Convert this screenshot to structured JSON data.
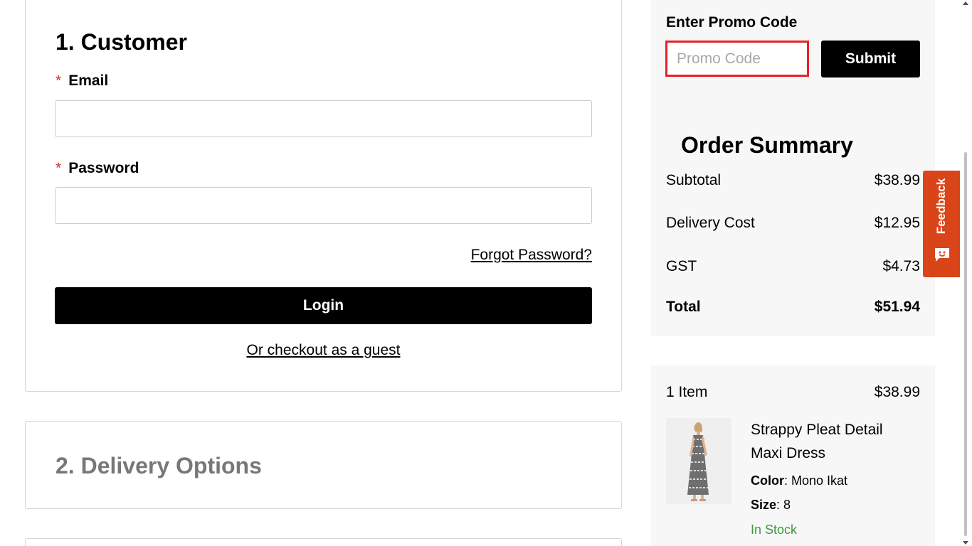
{
  "customer": {
    "title": "1. Customer",
    "email_label": "Email",
    "password_label": "Password",
    "required_marker": "*",
    "email_value": "",
    "password_value": "",
    "forgot_link": "Forgot Password?",
    "login_label": "Login",
    "guest_link": "Or checkout as a guest"
  },
  "delivery": {
    "title": "2. Delivery Options"
  },
  "promo": {
    "label": "Enter Promo Code",
    "placeholder": "Promo Code",
    "submit_label": "Submit"
  },
  "summary": {
    "title": "Order Summary",
    "rows": [
      {
        "label": "Subtotal",
        "value": "$38.99"
      },
      {
        "label": "Delivery Cost",
        "value": "$12.95"
      },
      {
        "label": "GST",
        "value": "$4.73"
      }
    ],
    "total": {
      "label": "Total",
      "value": "$51.94"
    }
  },
  "items": {
    "count_label": "1 Item",
    "count_value": "$38.99",
    "product": {
      "name": "Strappy Pleat Detail Maxi Dress",
      "color_label": "Color",
      "color_value": "Mono Ikat",
      "size_label": "Size",
      "size_value": "8",
      "stock": "In Stock",
      "image_icon": "dress-product-image"
    }
  },
  "feedback": {
    "label": "Feedback",
    "icon": "chat-face-icon"
  },
  "colors": {
    "accent_red": "#e8202a",
    "feedback_orange": "#d94418",
    "stock_green": "#3e9a3e",
    "button_black": "#000000"
  }
}
